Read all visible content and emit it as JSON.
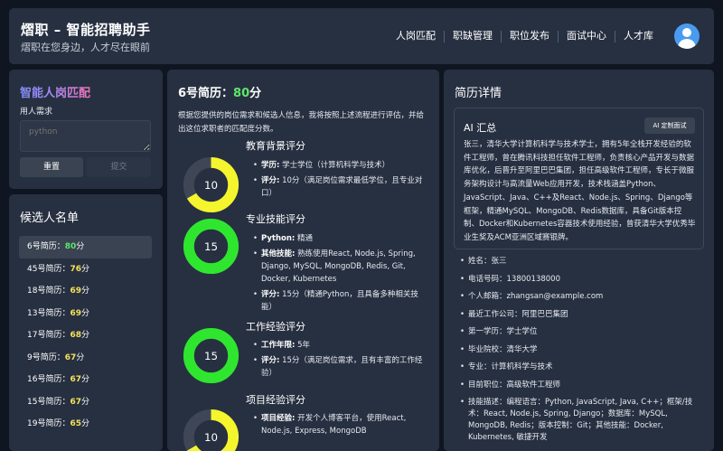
{
  "header": {
    "title": "熠职 – 智能招聘助手",
    "subtitle": "熠职在您身边，人才尽在眼前",
    "nav": [
      "人岗匹配",
      "职缺管理",
      "职位发布",
      "面试中心",
      "人才库"
    ]
  },
  "match": {
    "title": "智能人岗匹配",
    "req_label": "用人需求",
    "placeholder": "python",
    "reset_label": "重置",
    "submit_label": "提交"
  },
  "candidates": {
    "title": "候选人名单",
    "items": [
      {
        "name": "6号简历：",
        "score": "80",
        "unit": "分"
      },
      {
        "name": "45号简历：",
        "score": "76",
        "unit": "分"
      },
      {
        "name": "18号简历：",
        "score": "69",
        "unit": "分"
      },
      {
        "name": "13号简历：",
        "score": "69",
        "unit": "分"
      },
      {
        "name": "17号简历：",
        "score": "68",
        "unit": "分"
      },
      {
        "name": "9号简历：",
        "score": "67",
        "unit": "分"
      },
      {
        "name": "16号简历：",
        "score": "67",
        "unit": "分"
      },
      {
        "name": "15号简历：",
        "score": "67",
        "unit": "分"
      },
      {
        "name": "19号简历：",
        "score": "65",
        "unit": "分"
      }
    ]
  },
  "resume": {
    "title_prefix": "6号简历：",
    "score": "80",
    "unit": "分",
    "intro": "根据您提供的岗位需求和候选人信息，我将按照上述流程进行评估，并给出这位求职者的匹配度分数。",
    "sections": [
      {
        "title": "教育背景评分",
        "score": 10,
        "max": 15,
        "color": "#f5f52d",
        "items": [
          {
            "key": "学历:",
            "text": " 学士学位（计算机科学与技术）"
          },
          {
            "key": "评分:",
            "text": " 10分（满足岗位需求最低学位，且专业对口）"
          }
        ]
      },
      {
        "title": "专业技能评分",
        "score": 15,
        "max": 15,
        "color": "#2fe62f",
        "items": [
          {
            "key": "Python:",
            "text": " 精通"
          },
          {
            "key": "其他技能:",
            "text": " 熟练使用React, Node.js, Spring, Django, MySQL, MongoDB, Redis, Git, Docker, Kubernetes"
          },
          {
            "key": "评分:",
            "text": " 15分（精通Python，且具备多种相关技能）"
          }
        ]
      },
      {
        "title": "工作经验评分",
        "score": 15,
        "max": 15,
        "color": "#2fe62f",
        "items": [
          {
            "key": "工作年限:",
            "text": " 5年"
          },
          {
            "key": "评分:",
            "text": " 15分（满足岗位需求，且有丰富的工作经验）"
          }
        ]
      },
      {
        "title": "项目经验评分",
        "score": 10,
        "max": 15,
        "color": "#f5f52d",
        "items": [
          {
            "key": "项目经验:",
            "text": " 开发个人博客平台，使用React, Node.js, Express, MongoDB"
          }
        ]
      }
    ]
  },
  "detail": {
    "title": "简历详情",
    "ai_title": "AI 汇总",
    "ai_button": "AI 定制面试",
    "ai_summary": "张三，清华大学计算机科学与技术学士，拥有5年全栈开发经验的软件工程师，曾在腾讯科技担任软件工程师，负责核心产品开发与数据库优化，后晋升至阿里巴巴集团，担任高级软件工程师，专长于微服务架构设计与高流量Web应用开发，技术栈涵盖Python、JavaScript、Java、C++及React、Node.js、Spring、Django等框架，精通MySQL、MongoDB、Redis数据库，具备Git版本控制、Docker和Kubernetes容器技术使用经验，曾获清华大学优秀毕业生奖及ACM亚洲区域赛银牌。",
    "info": [
      "姓名：张三",
      "电话号码：13800138000",
      "个人邮箱：zhangsan@example.com",
      "最近工作公司：阿里巴巴集团",
      "第一学历：学士学位",
      "毕业院校：清华大学",
      "专业：计算机科学与技术",
      "目前职位：高级软件工程师",
      "技能描述：编程语言：Python, JavaScript, Java, C++；框架/技术：React, Node.js, Spring, Django；数据库：MySQL, MongoDB, Redis；版本控制：Git；其他技能：Docker, Kubernetes, 敏捷开发"
    ]
  }
}
